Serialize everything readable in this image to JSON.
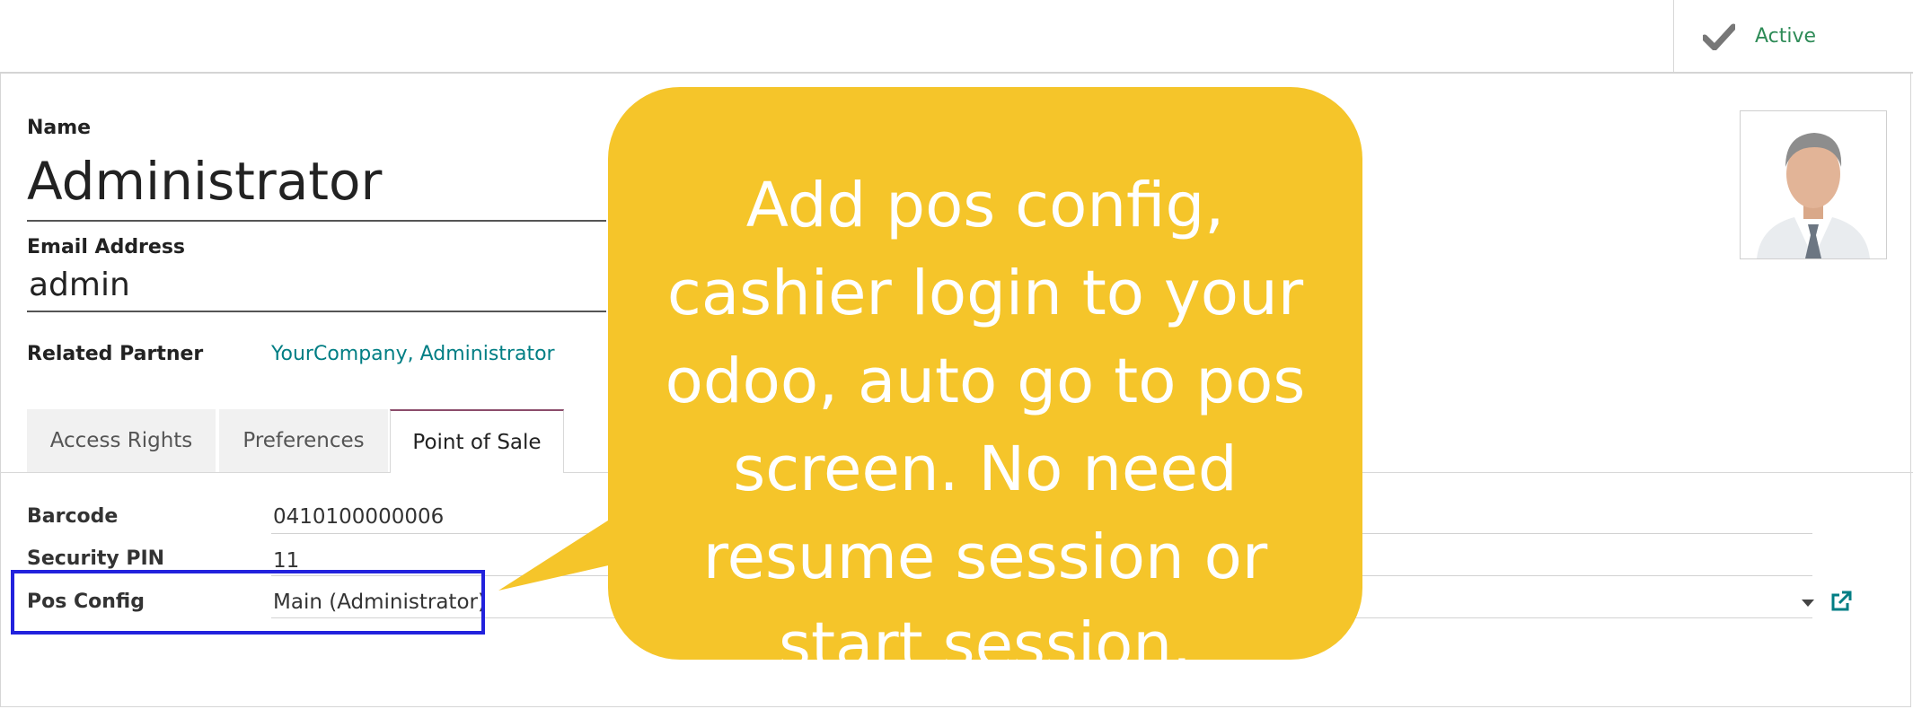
{
  "status": {
    "active_label": "Active"
  },
  "form": {
    "name_label": "Name",
    "name_value": "Administrator",
    "email_label": "Email Address",
    "email_value": "admin",
    "partner_label": "Related Partner",
    "partner_value": "YourCompany, Administrator"
  },
  "tabs": [
    {
      "label": "Access Rights"
    },
    {
      "label": "Preferences"
    },
    {
      "label": "Point of Sale",
      "active": true
    }
  ],
  "pos_fields": {
    "barcode_label": "Barcode",
    "barcode_value": "0410100000006",
    "pin_label": "Security PIN",
    "pin_value": "11",
    "pos_config_label": "Pos Config",
    "pos_config_value": "Main (Administrator)"
  },
  "callout": {
    "text": "Add pos config, cashier login to your odoo, auto go to pos screen. No need resume session or start session."
  },
  "colors": {
    "callout_bg": "#f5c52a",
    "link": "#017e84",
    "active": "#2e8b57",
    "highlight": "#2222dd"
  },
  "icons": [
    "check-icon",
    "external-link-icon",
    "dropdown-caret-icon",
    "user-avatar"
  ]
}
